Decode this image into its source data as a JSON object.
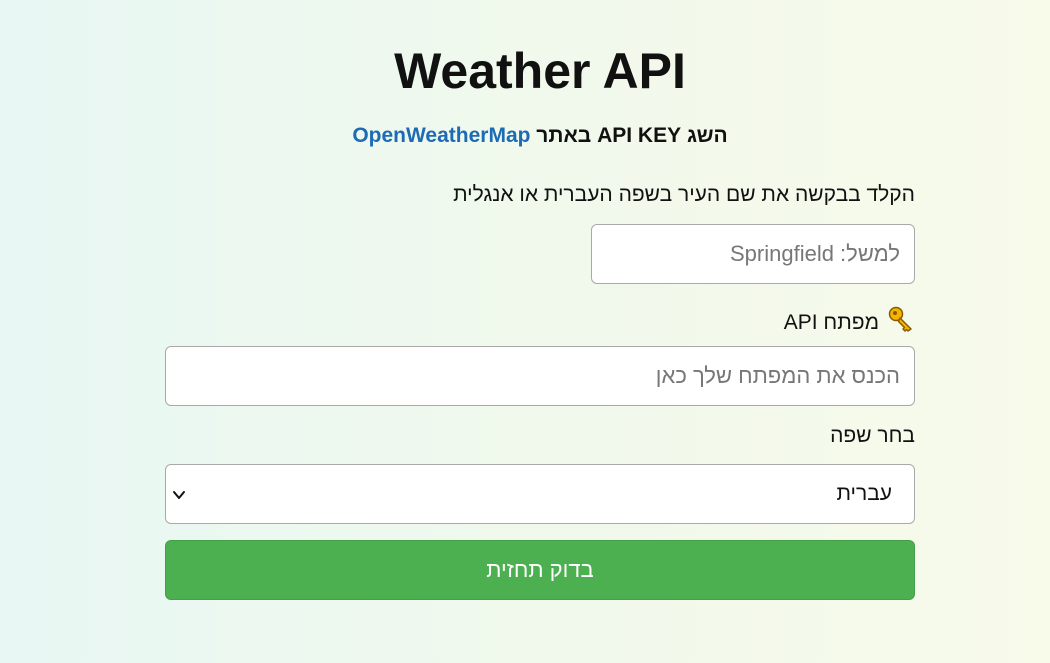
{
  "header": {
    "title": "Weather API",
    "subtitle_text": "השג API KEY באתר ",
    "subtitle_link": "OpenWeatherMap"
  },
  "form": {
    "city_label": "הקלד בבקשה את שם העיר בשפה העברית או אנגלית",
    "city_placeholder": "למשל: Springfield",
    "api_key_label": "מפתח API",
    "api_key_placeholder": "הכנס את המפתח שלך כאן",
    "language_label": "בחר שפה",
    "language_selected": "עברית",
    "submit_label": "בדוק תחזית"
  },
  "icons": {
    "key": "key-icon",
    "dropdown": "chevron-down-icon"
  },
  "colors": {
    "link": "#1d6bb5",
    "submit_bg": "#4caf50"
  }
}
